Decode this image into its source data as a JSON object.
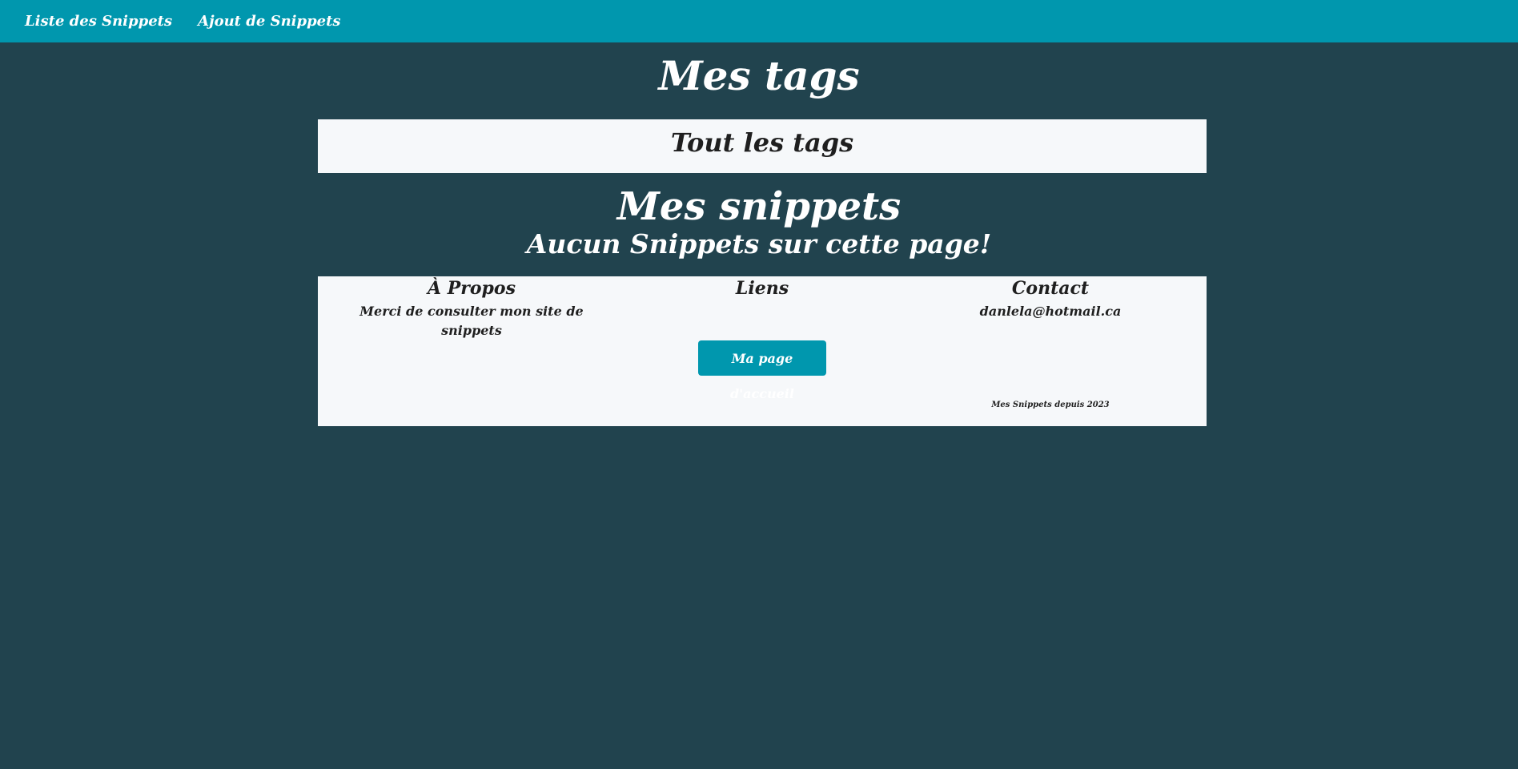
{
  "nav": {
    "links": [
      {
        "label": "Liste des Snippets"
      },
      {
        "label": "Ajout de Snippets"
      }
    ]
  },
  "tags_title": "Mes tags",
  "tags_panel": {
    "label": "Tout les tags"
  },
  "snippets": {
    "title": "Mes snippets",
    "empty_message": "Aucun Snippets sur cette page!"
  },
  "footer": {
    "about": {
      "heading": "À Propos",
      "text": "Merci de consulter mon site de snippets"
    },
    "links": {
      "heading": "Liens",
      "home_button": "Ma page d'accueil"
    },
    "contact": {
      "heading": "Contact",
      "email": "danlela@hotmail.ca"
    },
    "copyright": "Mes Snippets depuis 2023"
  },
  "colors": {
    "background": "#21434e",
    "navbar": "#0097ae",
    "panel": "#f6f8fa",
    "accent_button": "#0097ae"
  }
}
